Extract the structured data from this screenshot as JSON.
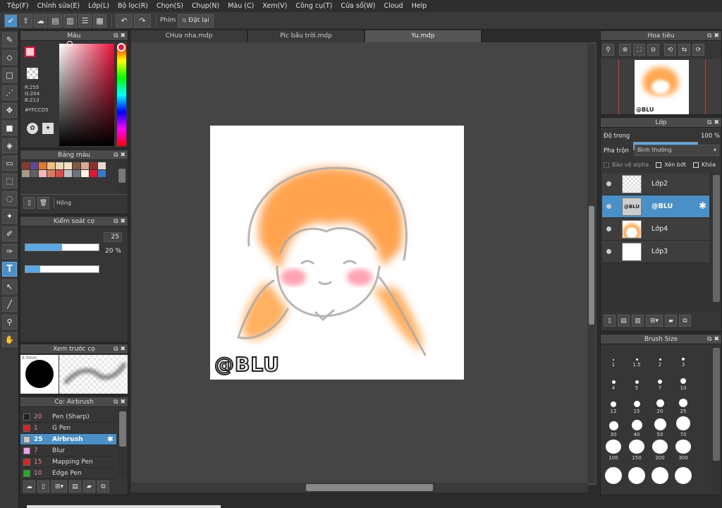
{
  "menu": [
    "Tệp(F)",
    "Chỉnh sửa(E)",
    "Lớp(L)",
    "Bộ lọc(R)",
    "Chọn(S)",
    "Chụp(N)",
    "Màu (C)",
    "Xem(V)",
    "Công cụ(T)",
    "Cửa sổ(W)",
    "Cloud",
    "Help"
  ],
  "toolbar": {
    "phim_label": "Phím",
    "reset_label": "Đặt lại"
  },
  "tabs": [
    {
      "label": "CHưa nha.mdp"
    },
    {
      "label": "Pic bầu trời.mdp"
    },
    {
      "label": "Yu.mdp"
    }
  ],
  "color_panel": {
    "title": "Màu",
    "r": "R:255",
    "g": "G:204",
    "b": "B:213",
    "hex": "#FFCCD5",
    "colors": {
      "fg": "#ffccd5",
      "accent": "#e8143c"
    }
  },
  "palette_panel": {
    "title": "Bảng màu",
    "swatches": [
      "#8b3a2a",
      "#5a4a9a",
      "#e07830",
      "#f0c080",
      "#e8d8b8",
      "#f8e0c0",
      "#7a5a40",
      "#d8a890",
      "#8a3030",
      "#e8d8d0",
      "#a89888",
      "#606060",
      "#f0b8b8",
      "#d08060",
      "#e04848",
      "#c0c0c0",
      "#707080",
      "#f8f0e0",
      "#e01830",
      "#3a78c8"
    ],
    "label": "Hồng"
  },
  "brush_control": {
    "title": "Kiểm soát cọ",
    "size": "25",
    "opacity": "20 %",
    "size_frac": 0.5,
    "opacity_frac": 0.2
  },
  "brush_preview": {
    "title": "Xem trước cọ",
    "size_label": "6.0mm"
  },
  "brush_list": {
    "title": "Cọ: Airbrush",
    "items": [
      {
        "num": "20",
        "name": "Pen (Sharp)",
        "color": "#222222"
      },
      {
        "num": "1",
        "name": "G Pen",
        "color": "#e02020"
      },
      {
        "num": "25",
        "name": "Airbrush",
        "color": "#c8c8c8",
        "selected": true
      },
      {
        "num": "7",
        "name": "Blur",
        "color": "#f0a0f0"
      },
      {
        "num": "15",
        "name": "Mapping Pen",
        "color": "#e02020"
      },
      {
        "num": "10",
        "name": "Edge Pen",
        "color": "#20b020"
      }
    ]
  },
  "canvas": {
    "watermark": "@BLU"
  },
  "navigator": {
    "title": "Hoa tiêu",
    "thumb_text": "@BLU"
  },
  "layer_panel": {
    "title": "Lớp",
    "opacity_label": "Độ trong",
    "opacity_value": "100 %",
    "opacity_frac": 1.0,
    "blend_label": "Pha trộn",
    "blend_value": "Bình thường",
    "protect_alpha": "Bảo vệ alpha",
    "clipping": "Xén bớt",
    "lock": "Khóa",
    "layers": [
      {
        "name": "Lớp2",
        "selected": false
      },
      {
        "name": "@BLU",
        "selected": true
      },
      {
        "name": "Lớp4",
        "selected": false
      },
      {
        "name": "Lớp3",
        "selected": false
      }
    ]
  },
  "brush_size": {
    "title": "Brush Size",
    "sizes": [
      "1",
      "1.5",
      "2",
      "3",
      "4",
      "5",
      "7",
      "10",
      "12",
      "15",
      "20",
      "25",
      "30",
      "40",
      "50",
      "70",
      "100",
      "150",
      "200",
      "300"
    ]
  }
}
